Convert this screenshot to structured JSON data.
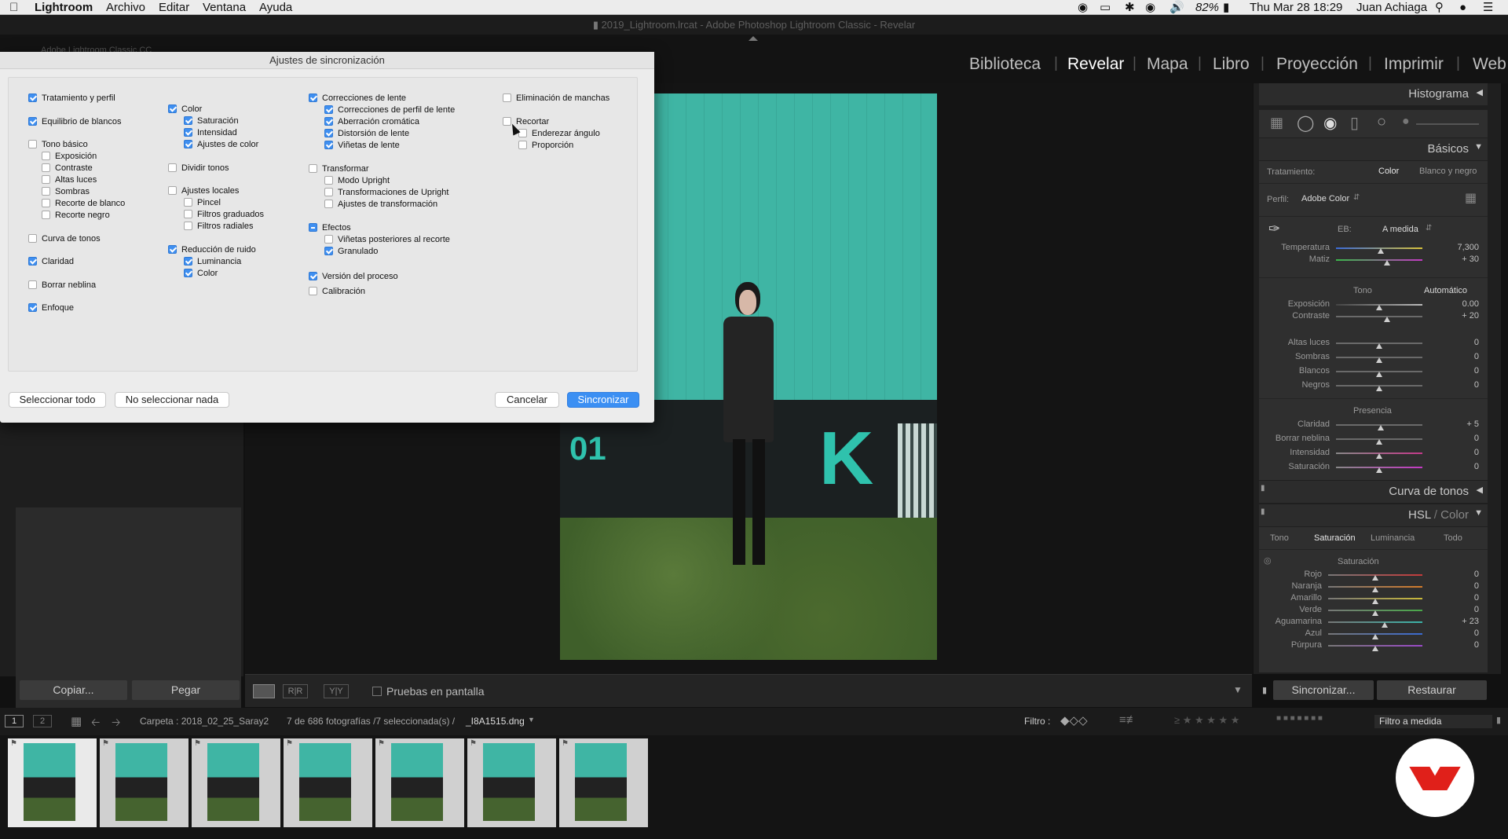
{
  "menubar": {
    "app": "Lightroom",
    "items": [
      "Archivo",
      "Editar",
      "Ventana",
      "Ayuda"
    ],
    "battery": "82%",
    "clock": "Thu Mar 28  18:29",
    "user": "Juan Achiaga"
  },
  "window_title": "2019_Lightroom.lrcat - Adobe Photoshop Lightroom Classic - Revelar",
  "identity": "Adobe Lightroom Classic CC",
  "modules": {
    "items": [
      "Biblioteca",
      "Revelar",
      "Mapa",
      "Libro",
      "Proyección",
      "Imprimir",
      "Web"
    ],
    "active": "Revelar"
  },
  "dialog": {
    "title": "Ajustes de sincronización",
    "col1": [
      {
        "label": "Tratamiento y perfil",
        "checked": true
      },
      {
        "label": "Equilibrio de blancos",
        "checked": true
      },
      {
        "label": "Tono básico",
        "checked": false
      },
      {
        "label": "Exposición",
        "checked": false
      },
      {
        "label": "Contraste",
        "checked": false
      },
      {
        "label": "Altas luces",
        "checked": false
      },
      {
        "label": "Sombras",
        "checked": false
      },
      {
        "label": "Recorte de blanco",
        "checked": false
      },
      {
        "label": "Recorte negro",
        "checked": false
      },
      {
        "label": "Curva de tonos",
        "checked": false
      },
      {
        "label": "Claridad",
        "checked": true
      },
      {
        "label": "Borrar neblina",
        "checked": false
      },
      {
        "label": "Enfoque",
        "checked": true
      }
    ],
    "col2": [
      {
        "label": "Color",
        "checked": true
      },
      {
        "label": "Saturación",
        "checked": true
      },
      {
        "label": "Intensidad",
        "checked": true
      },
      {
        "label": "Ajustes de color",
        "checked": true
      },
      {
        "label": "Dividir tonos",
        "checked": false
      },
      {
        "label": "Ajustes locales",
        "checked": false
      },
      {
        "label": "Pincel",
        "checked": false
      },
      {
        "label": "Filtros graduados",
        "checked": false
      },
      {
        "label": "Filtros radiales",
        "checked": false
      },
      {
        "label": "Reducción de ruido",
        "checked": true
      },
      {
        "label": "Luminancia",
        "checked": true
      },
      {
        "label": "Color",
        "checked": true
      }
    ],
    "col3": [
      {
        "label": "Correcciones de lente",
        "checked": true
      },
      {
        "label": "Correcciones de perfil de lente",
        "checked": true
      },
      {
        "label": "Aberración cromática",
        "checked": true
      },
      {
        "label": "Distorsión de lente",
        "checked": true
      },
      {
        "label": "Viñetas de lente",
        "checked": true
      },
      {
        "label": "Transformar",
        "checked": false
      },
      {
        "label": "Modo Upright",
        "checked": false
      },
      {
        "label": "Transformaciones de Upright",
        "checked": false
      },
      {
        "label": "Ajustes de transformación",
        "checked": false
      },
      {
        "label": "Efectos",
        "checked": "mixed"
      },
      {
        "label": "Viñetas posteriores al recorte",
        "checked": false
      },
      {
        "label": "Granulado",
        "checked": true
      },
      {
        "label": "Versión del proceso",
        "checked": true
      },
      {
        "label": "Calibración",
        "checked": false
      }
    ],
    "col4": [
      {
        "label": "Eliminación de manchas",
        "checked": false
      },
      {
        "label": "Recortar",
        "checked": false
      },
      {
        "label": "Enderezar ángulo",
        "checked": false
      },
      {
        "label": "Proporción",
        "checked": false
      }
    ],
    "btn_select_all": "Seleccionar todo",
    "btn_select_none": "No seleccionar nada",
    "btn_cancel": "Cancelar",
    "btn_sync": "Sincronizar"
  },
  "right": {
    "histogram": "Histograma",
    "basics": "Básicos",
    "treatment_label": "Tratamiento:",
    "treatment_color": "Color",
    "treatment_bw": "Blanco y negro",
    "profile_label": "Perfil:",
    "profile_value": "Adobe Color",
    "wb_label": "EB:",
    "wb_value": "A medida",
    "temp": {
      "label": "Temperatura",
      "value": "7,300",
      "pos": 0.52
    },
    "tint": {
      "label": "Matiz",
      "value": "+ 30",
      "pos": 0.59
    },
    "tone_label": "Tono",
    "auto_label": "Automático",
    "exposure": {
      "label": "Exposición",
      "value": "0.00",
      "pos": 0.5
    },
    "contrast": {
      "label": "Contraste",
      "value": "+ 20",
      "pos": 0.59
    },
    "highlights": {
      "label": "Altas luces",
      "value": "0",
      "pos": 0.5
    },
    "shadows": {
      "label": "Sombras",
      "value": "0",
      "pos": 0.5
    },
    "whites": {
      "label": "Blancos",
      "value": "0",
      "pos": 0.5
    },
    "blacks": {
      "label": "Negros",
      "value": "0",
      "pos": 0.5
    },
    "presence": "Presencia",
    "clarity": {
      "label": "Claridad",
      "value": "+ 5",
      "pos": 0.52
    },
    "dehaze": {
      "label": "Borrar neblina",
      "value": "0",
      "pos": 0.5
    },
    "vibrance": {
      "label": "Intensidad",
      "value": "0",
      "pos": 0.5
    },
    "saturation": {
      "label": "Saturación",
      "value": "0",
      "pos": 0.5
    },
    "tone_curve": "Curva de tonos",
    "hsl_title": "HSL",
    "hsl_sep": " / ",
    "color_title": "Color",
    "hsl_tabs": [
      "Tono",
      "Saturación",
      "Luminancia",
      "Todo"
    ],
    "hsl_active": "Saturación",
    "hsl_section": "Saturación",
    "hsl_rows": [
      {
        "label": "Rojo",
        "value": "0",
        "pos": 0.5,
        "color": "#c43a3a"
      },
      {
        "label": "Naranja",
        "value": "0",
        "pos": 0.5,
        "color": "#d27a2a"
      },
      {
        "label": "Amarillo",
        "value": "0",
        "pos": 0.5,
        "color": "#c9b93a"
      },
      {
        "label": "Verde",
        "value": "0",
        "pos": 0.5,
        "color": "#4aa84a"
      },
      {
        "label": "Aguamarina",
        "value": "+ 23",
        "pos": 0.6,
        "color": "#3ab3a8"
      },
      {
        "label": "Azul",
        "value": "0",
        "pos": 0.5,
        "color": "#3a6ad0"
      },
      {
        "label": "Púrpura",
        "value": "0",
        "pos": 0.5,
        "color": "#9a4ac8"
      }
    ],
    "btn_sync": "Sincronizar...",
    "btn_reset": "Restaurar"
  },
  "left": {
    "btn_copy": "Copiar...",
    "btn_paste": "Pegar"
  },
  "toolbar": {
    "proof": "Pruebas en pantalla"
  },
  "filmbar": {
    "folder": "Carpeta : 2018_02_25_Saray2",
    "count": "7 de 686 fotografías /7 seleccionada(s) /",
    "file": "_I8A1515.dng",
    "filter_label": "Filtro :",
    "filter_value": "Filtro a medida",
    "view1": "1",
    "view2": "2"
  },
  "thumbs": 7,
  "photo": {
    "sign_number": "01",
    "sign_letter": "K"
  },
  "colors": {
    "accent": "#3b8ff3",
    "teal": "#3fb5a4",
    "panel": "#1f1f1f"
  }
}
